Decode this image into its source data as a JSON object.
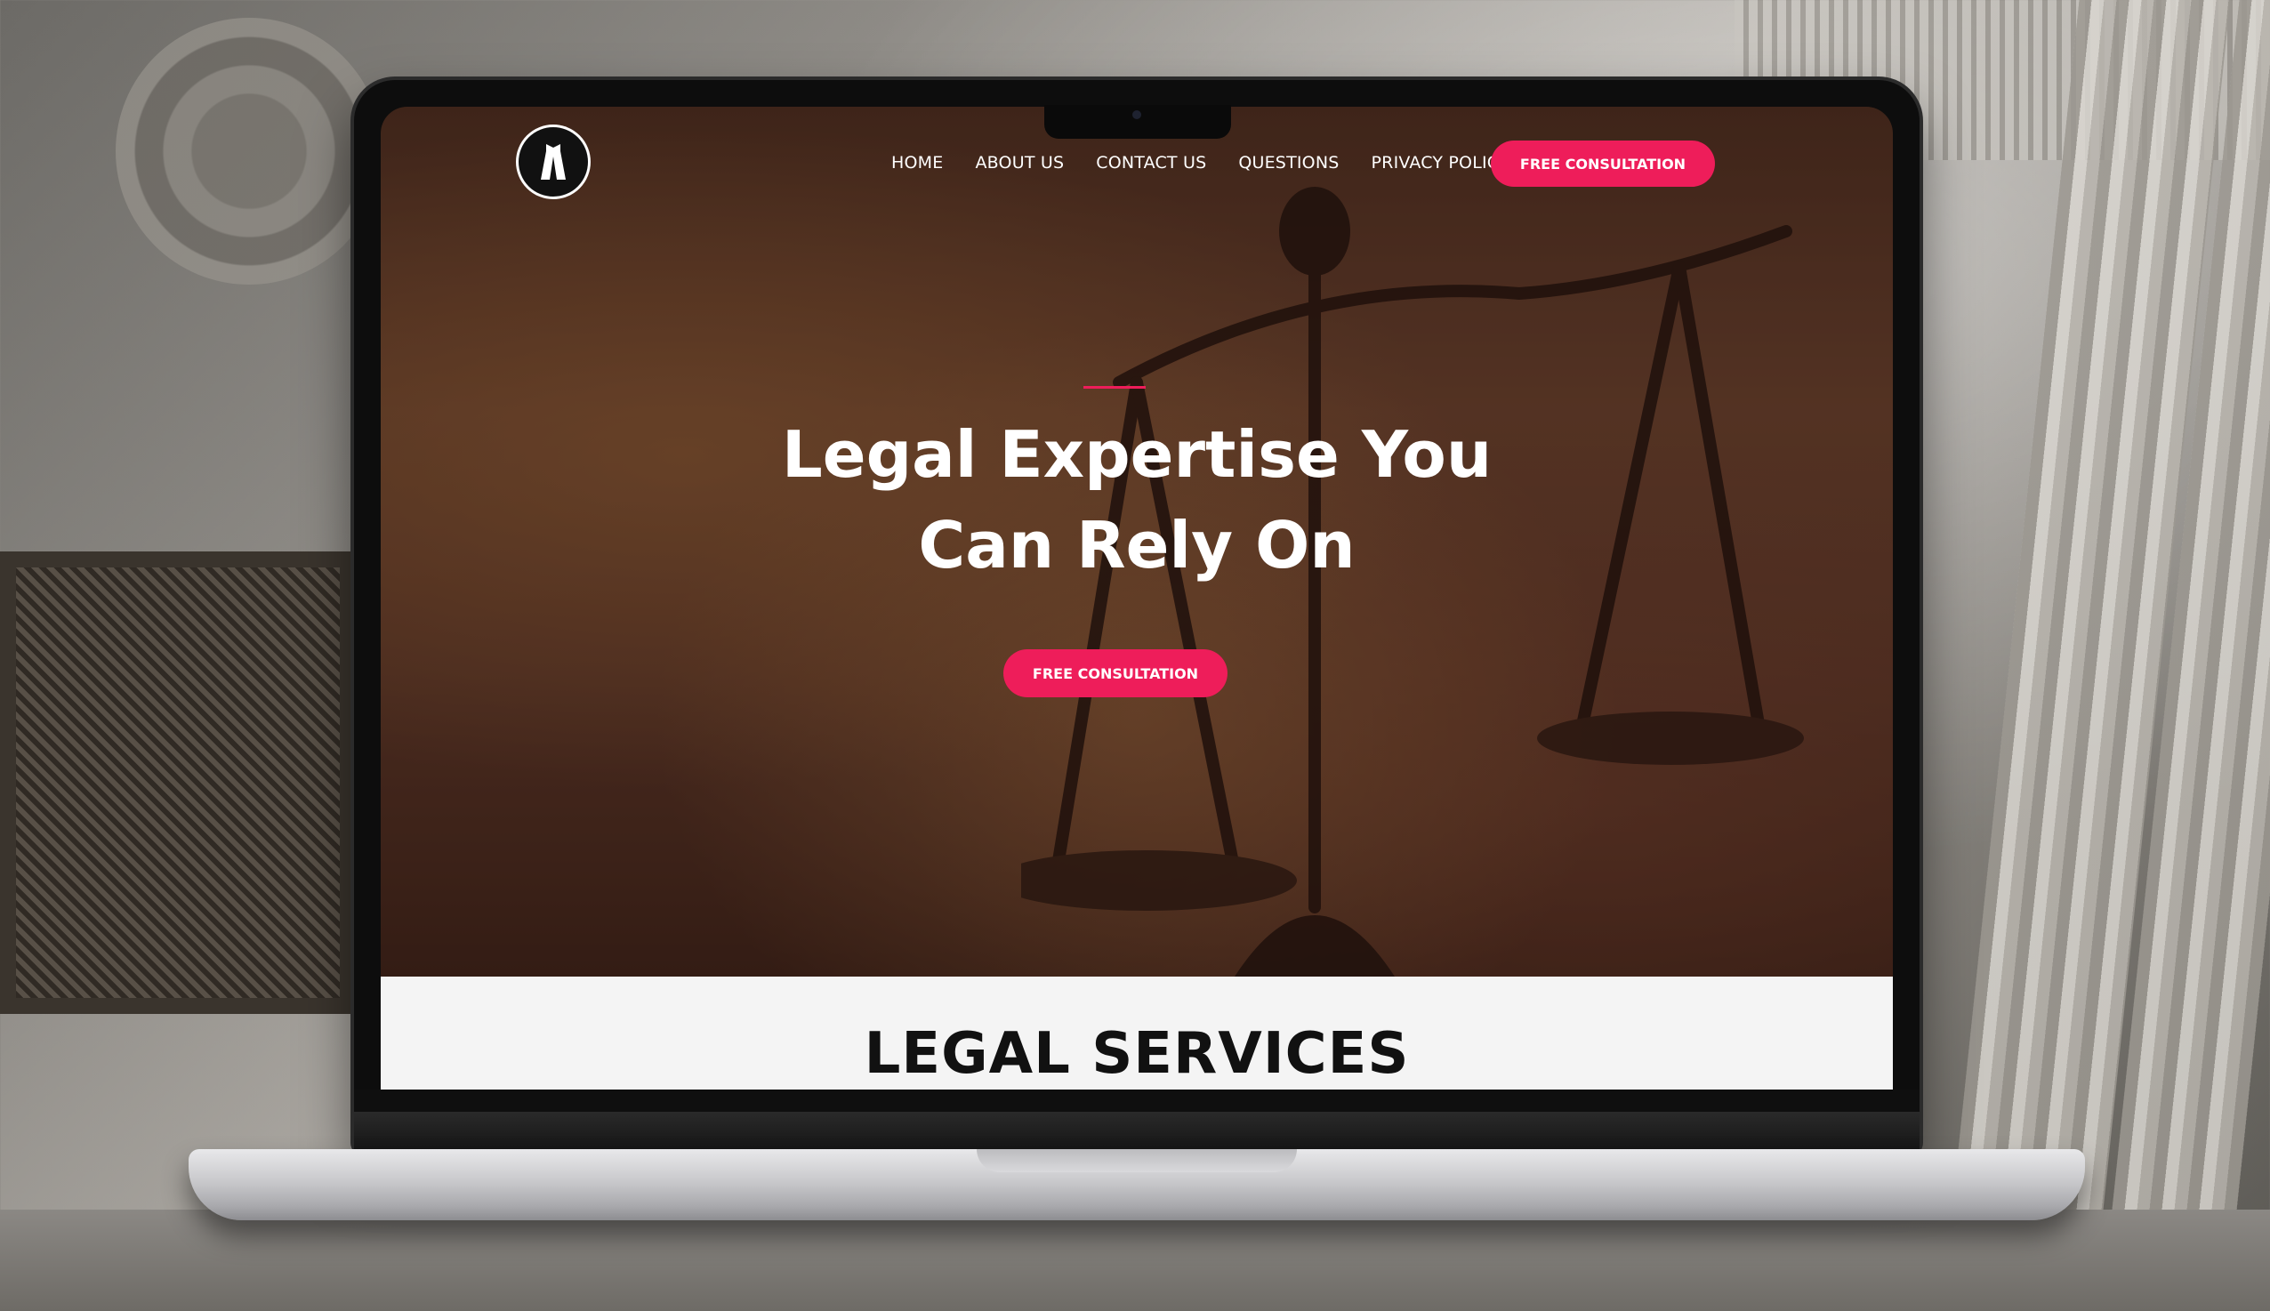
{
  "nav": {
    "links": [
      "HOME",
      "ABOUT US",
      "CONTACT US",
      "QUESTIONS",
      "PRIVACY POLICY"
    ],
    "cta_label": "FREE CONSULTATION"
  },
  "hero": {
    "title_line1": "Legal Expertise You",
    "title_line2": "Can Rely On",
    "cta_label": "FREE CONSULTATION"
  },
  "services": {
    "title": "LEGAL SERVICES"
  },
  "colors": {
    "accent": "#ee1d5a",
    "services_bg": "#f4f4f4"
  }
}
